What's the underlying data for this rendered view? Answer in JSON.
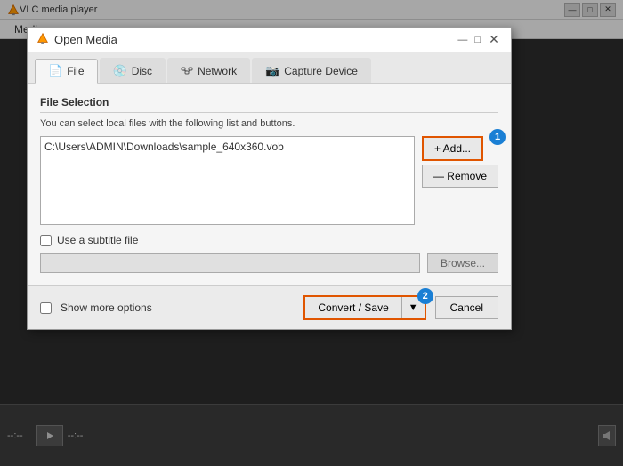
{
  "vlc": {
    "titlebar": {
      "title": "VLC media player",
      "controls": [
        "—",
        "□",
        "✕"
      ]
    },
    "menubar": {
      "items": [
        "Medi"
      ]
    },
    "bottom": {
      "time_left": "--:--",
      "time_right": "--:--"
    }
  },
  "dialog": {
    "title": "Open Media",
    "tabs": [
      {
        "id": "file",
        "label": "File",
        "icon": "📄",
        "active": true
      },
      {
        "id": "disc",
        "label": "Disc",
        "icon": "💿"
      },
      {
        "id": "network",
        "label": "Network",
        "icon": "🖧"
      },
      {
        "id": "capture",
        "label": "Capture Device",
        "icon": "📷"
      }
    ],
    "file_selection": {
      "section_label": "File Selection",
      "hint": "You can select local files with the following list and buttons.",
      "file_path": "C:\\Users\\ADMIN\\Downloads\\sample_640x360.vob",
      "add_label": "+ Add...",
      "remove_label": "— Remove",
      "badge_add": "1"
    },
    "subtitle": {
      "checkbox_label": "Use a subtitle file",
      "browse_label": "Browse..."
    },
    "bottom": {
      "show_more_label": "Show more options",
      "convert_label": "Convert / Save",
      "cancel_label": "Cancel",
      "badge_convert": "2"
    }
  }
}
